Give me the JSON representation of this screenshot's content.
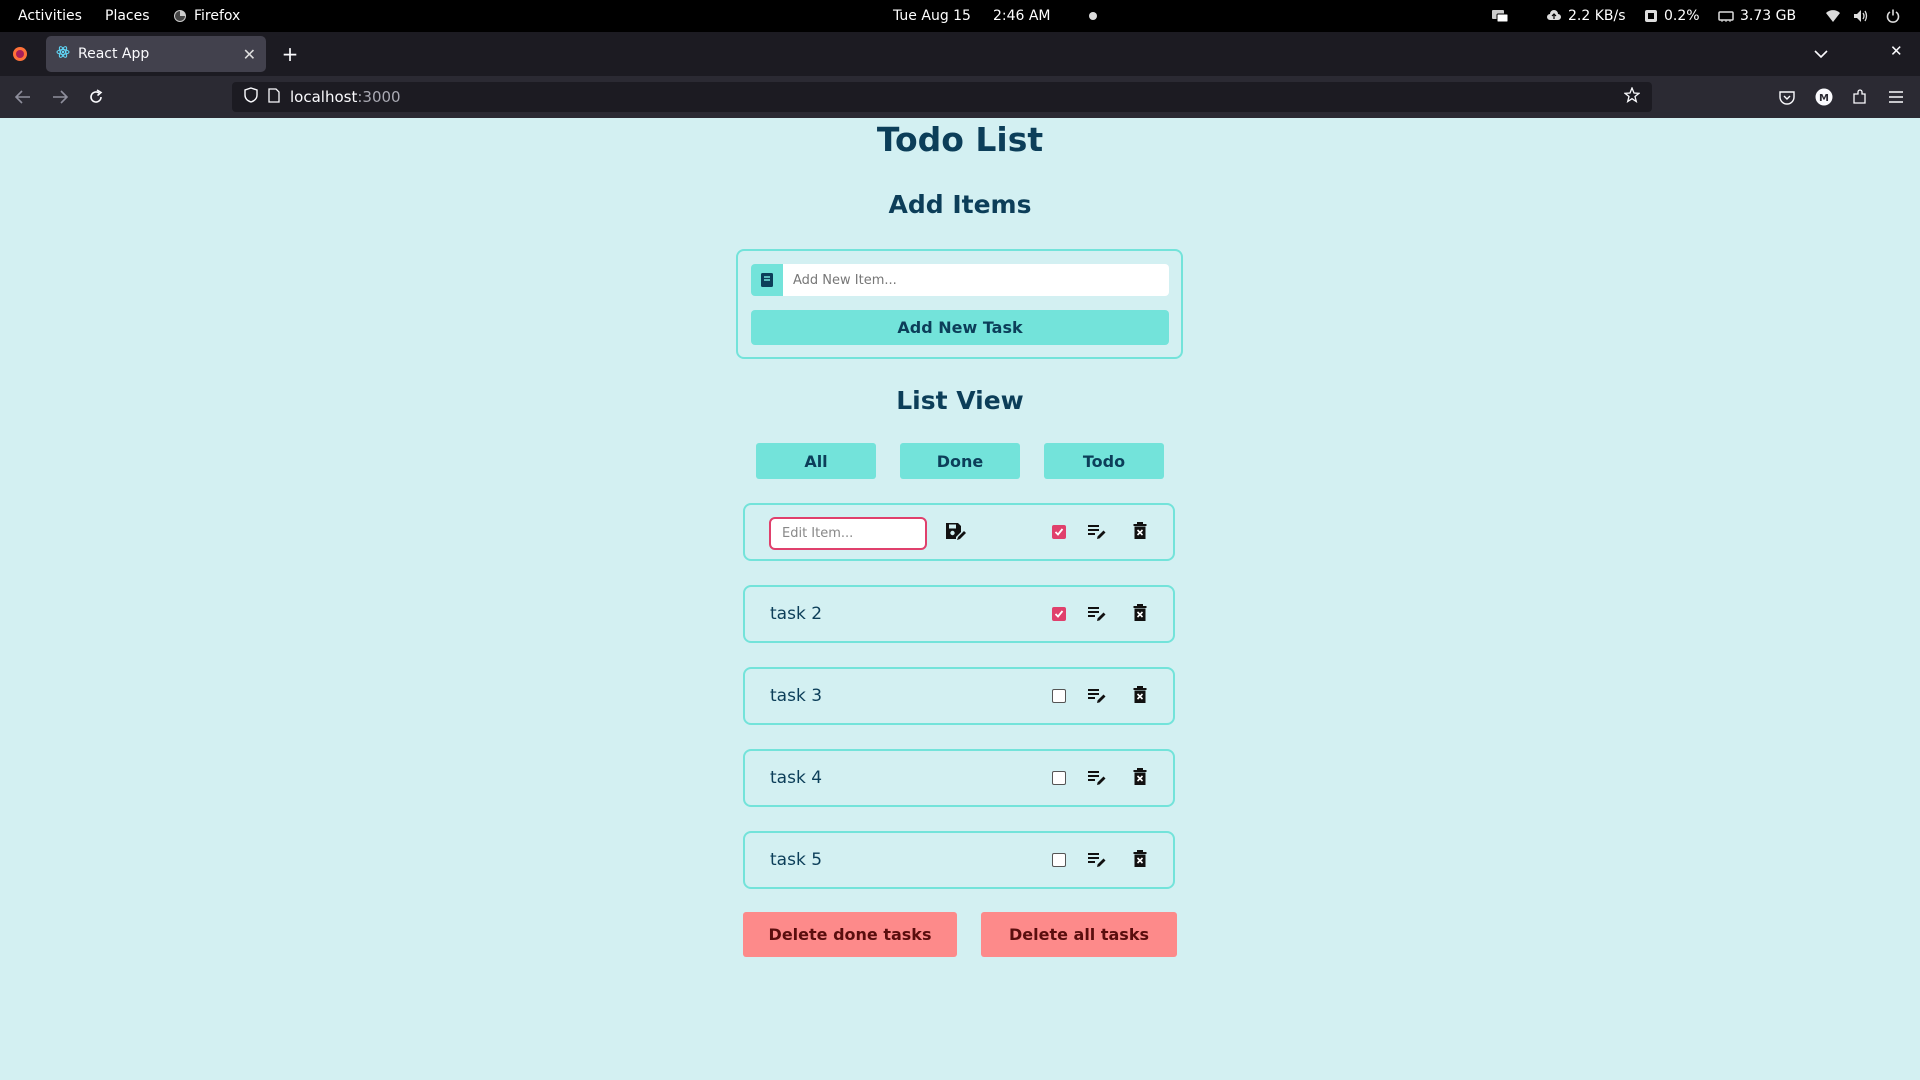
{
  "topbar": {
    "activities": "Activities",
    "places": "Places",
    "app_name": "Firefox",
    "date": "Tue Aug 15",
    "time": "2:46 AM",
    "net_speed": "2.2 KB/s",
    "cpu": "0.2%",
    "memory": "3.73 GB"
  },
  "browser": {
    "tab_title": "React App",
    "url_host": "localhost",
    "url_port": ":3000"
  },
  "app": {
    "title": "Todo List",
    "add_section_title": "Add Items",
    "add_placeholder": "Add New Item...",
    "add_button": "Add New Task",
    "list_section_title": "List View",
    "filters": {
      "all": "All",
      "done": "Done",
      "todo": "Todo"
    },
    "edit_placeholder": "Edit Item...",
    "tasks": [
      {
        "label": "",
        "done": true,
        "editing": true
      },
      {
        "label": "task 2",
        "done": true,
        "editing": false
      },
      {
        "label": "task 3",
        "done": false,
        "editing": false
      },
      {
        "label": "task 4",
        "done": false,
        "editing": false
      },
      {
        "label": "task 5",
        "done": false,
        "editing": false
      }
    ],
    "delete_done_button": "Delete done tasks",
    "delete_all_button": "Delete all tasks"
  },
  "colors": {
    "page_bg": "#d3f0f2",
    "accent": "#73e3da",
    "heading": "#0c3e59",
    "check": "#e0406c",
    "danger": "#fd8a8a"
  }
}
